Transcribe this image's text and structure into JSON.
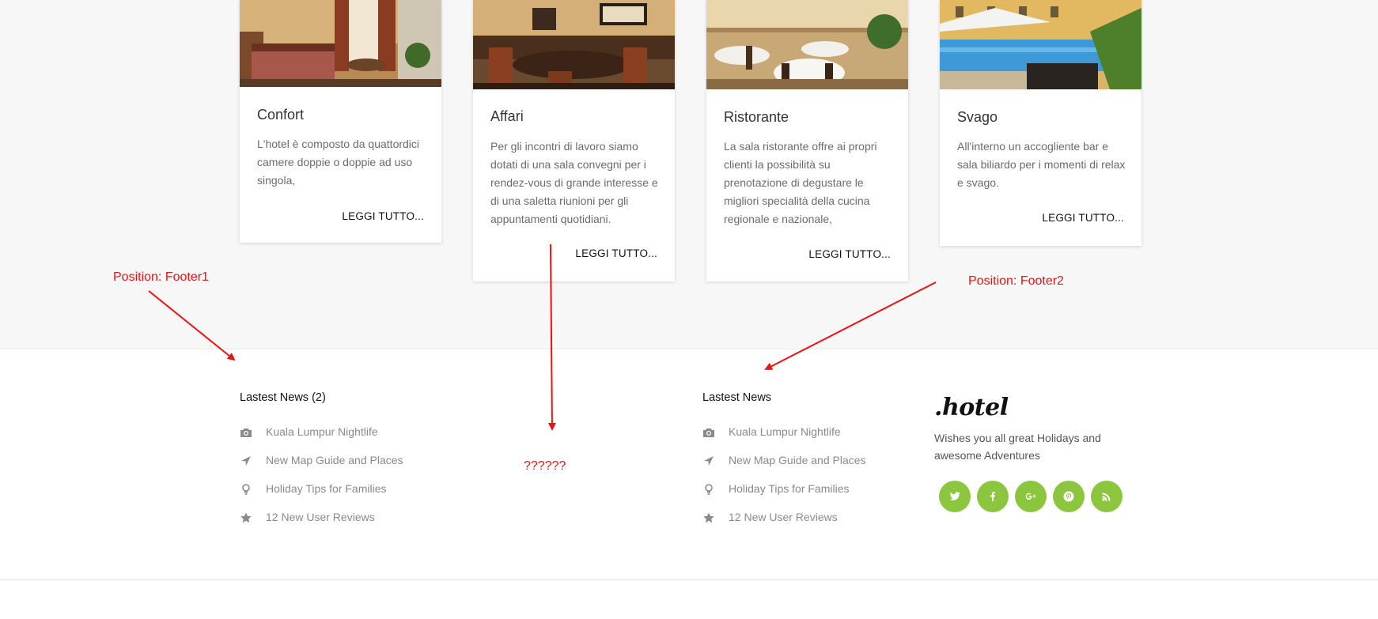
{
  "cards": [
    {
      "title": "Confort",
      "text": "L'hotel è composto da quattordici camere doppie o doppie ad uso singola,",
      "link": "LEGGI TUTTO..."
    },
    {
      "title": "Affari",
      "text": "Per gli incontri di lavoro siamo dotati di una sala convegni per i rendez-vous di grande interesse e di una saletta riunioni per gli appuntamenti quotidiani.",
      "link": "LEGGI TUTTO..."
    },
    {
      "title": "Ristorante",
      "text": "La sala ristorante offre ai propri clienti la possibilità su prenotazione di degustare le migliori specialità della cucina regionale e nazionale,",
      "link": "LEGGI TUTTO..."
    },
    {
      "title": "Svago",
      "text": "All'interno un accogliente bar e sala biliardo per i momenti di relax e svago.",
      "link": "LEGGI TUTTO..."
    }
  ],
  "annotations": {
    "footer1": "Position: Footer1",
    "footer2": "Position: Footer2",
    "unknown": "??????",
    "color": "#ee1111"
  },
  "footer1": {
    "heading": "Lastest News (2)",
    "items": [
      {
        "label": "Kuala Lumpur Nightlife",
        "icon": "camera-icon"
      },
      {
        "label": "New Map Guide and Places",
        "icon": "location-arrow-icon"
      },
      {
        "label": "Holiday Tips for Families",
        "icon": "lightbulb-icon"
      },
      {
        "label": "12 New User Reviews",
        "icon": "star-icon"
      }
    ]
  },
  "footer2": {
    "heading": "Lastest News",
    "items": [
      {
        "label": "Kuala Lumpur Nightlife",
        "icon": "camera-icon"
      },
      {
        "label": "New Map Guide and Places",
        "icon": "location-arrow-icon"
      },
      {
        "label": "Holiday Tips for Families",
        "icon": "lightbulb-icon"
      },
      {
        "label": "12 New User Reviews",
        "icon": "star-icon"
      }
    ]
  },
  "brand": {
    "logo": ".hotel",
    "tagline": "Wishes you all great Holidays and awesome Adventures",
    "socials": [
      "twitter-icon",
      "facebook-icon",
      "google-plus-icon",
      "pinterest-icon",
      "rss-icon"
    ],
    "accent": "#8cc63f"
  }
}
